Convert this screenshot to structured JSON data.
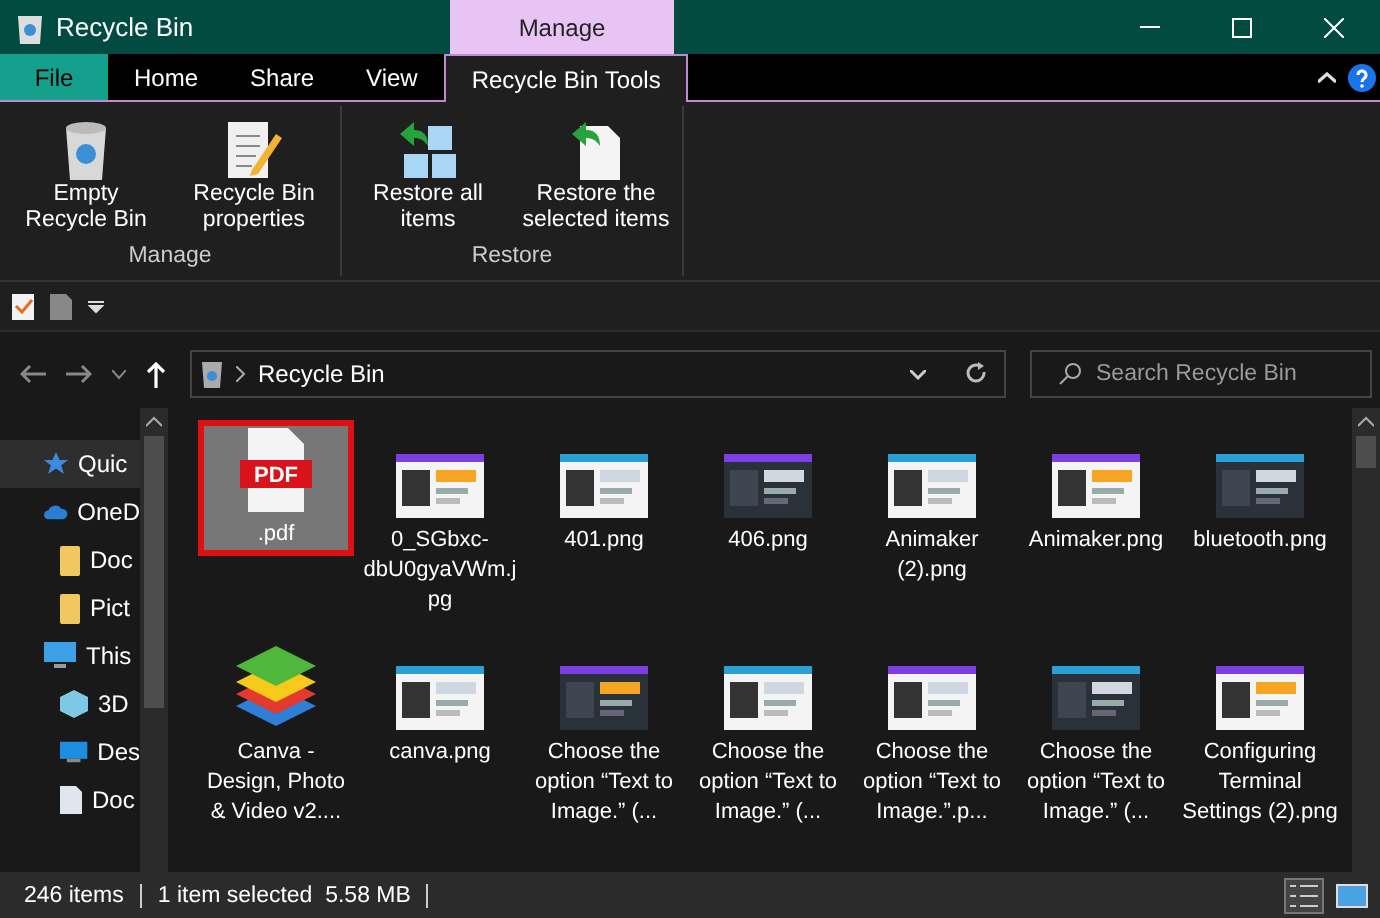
{
  "window": {
    "title": "Recycle Bin",
    "context_tab": "Manage"
  },
  "ribbon_tabs": [
    {
      "label": "File",
      "kind": "file",
      "selected": false
    },
    {
      "label": "Home",
      "kind": "tab",
      "selected": false
    },
    {
      "label": "Share",
      "kind": "tab",
      "selected": false
    },
    {
      "label": "View",
      "kind": "tab",
      "selected": false
    },
    {
      "label": "Recycle Bin Tools",
      "kind": "tab",
      "selected": true
    }
  ],
  "ribbon_groups": [
    {
      "label": "Manage",
      "buttons": [
        "Empty Recycle Bin",
        "Recycle Bin properties"
      ]
    },
    {
      "label": "Restore",
      "buttons": [
        "Restore all items",
        "Restore the selected items"
      ]
    }
  ],
  "address": {
    "path": "Recycle Bin",
    "search_placeholder": "Search Recycle Bin"
  },
  "sidebar": {
    "items": [
      {
        "label": "Quic",
        "kind": "star",
        "selected": true
      },
      {
        "label": "OneD",
        "kind": "cloud",
        "selected": false,
        "children": [
          {
            "label": "Doc",
            "kind": "folder",
            "selected": false
          },
          {
            "label": "Pict",
            "kind": "folder",
            "selected": false
          }
        ]
      },
      {
        "label": "This",
        "kind": "computer",
        "selected": false,
        "children": [
          {
            "label": "3D",
            "kind": "cube",
            "selected": false
          },
          {
            "label": "Des",
            "kind": "desktop",
            "selected": false
          },
          {
            "label": "Doc",
            "kind": "document",
            "selected": false
          }
        ]
      }
    ]
  },
  "files": [
    {
      "name": ".pdf",
      "kind": "pdf",
      "badge": "PDF",
      "selected": true
    },
    {
      "name": "0_SGbxc-dbU0gyaVWm.jpg",
      "kind": "picture",
      "selected": false
    },
    {
      "name": "401.png",
      "kind": "picture",
      "selected": false
    },
    {
      "name": "406.png",
      "kind": "picture",
      "selected": false
    },
    {
      "name": "Animaker (2).png",
      "kind": "picture",
      "selected": false
    },
    {
      "name": "Animaker.png",
      "kind": "picture",
      "selected": false
    },
    {
      "name": "bluetooth.png",
      "kind": "picture",
      "selected": false
    },
    {
      "name": "Canva - Design, Photo & Video v2....",
      "kind": "app",
      "selected": false
    },
    {
      "name": "canva.png",
      "kind": "picture",
      "selected": false
    },
    {
      "name": "Choose the option “Text to Image.” (...",
      "kind": "picture",
      "selected": false
    },
    {
      "name": "Choose the option “Text to Image.” (...",
      "kind": "picture",
      "selected": false
    },
    {
      "name": "Choose the option “Text to Image.”.p...",
      "kind": "picture",
      "selected": false
    },
    {
      "name": "Choose the option “Text to Image.” (...",
      "kind": "picture",
      "selected": false
    },
    {
      "name": "Configuring Terminal Settings (2).png",
      "kind": "picture",
      "selected": false
    }
  ],
  "status_bar": {
    "count": "246 items",
    "selection": "1 item selected  5.58 MB"
  }
}
